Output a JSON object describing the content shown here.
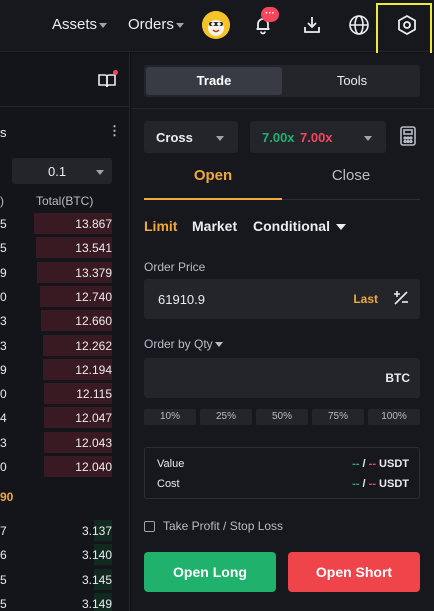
{
  "topbar": {
    "assets_label": "Assets",
    "orders_label": "Orders",
    "notification_badge": "···"
  },
  "orderbook": {
    "title_fragment": "s",
    "depth_value": "0.1",
    "col_left": ")",
    "col_total": "Total(BTC)",
    "asks": [
      {
        "left": "5",
        "total": "13.867",
        "fill": 0.85
      },
      {
        "left": "5",
        "total": "13.541",
        "fill": 0.83
      },
      {
        "left": "9",
        "total": "13.379",
        "fill": 0.82
      },
      {
        "left": "0",
        "total": "12.740",
        "fill": 0.78
      },
      {
        "left": "3",
        "total": "12.660",
        "fill": 0.77
      },
      {
        "left": "3",
        "total": "12.262",
        "fill": 0.75
      },
      {
        "left": "9",
        "total": "12.194",
        "fill": 0.75
      },
      {
        "left": "0",
        "total": "12.115",
        "fill": 0.74
      },
      {
        "left": "4",
        "total": "12.047",
        "fill": 0.74
      },
      {
        "left": "3",
        "total": "12.043",
        "fill": 0.74
      },
      {
        "left": "0",
        "total": "12.040",
        "fill": 0.74
      }
    ],
    "mid_price_fragment": "90",
    "bids": [
      {
        "left": "7",
        "total": "3.137",
        "fill": 0.2
      },
      {
        "left": "6",
        "total": "3.140",
        "fill": 0.2
      },
      {
        "left": "5",
        "total": "3.145",
        "fill": 0.2
      },
      {
        "left": "5",
        "total": "3.149",
        "fill": 0.2
      }
    ],
    "colors": {
      "ask_bar": "#3a1a22",
      "bid_bar": "#12291f"
    }
  },
  "panel": {
    "tabs": {
      "trade": "Trade",
      "tools": "Tools"
    },
    "margin_mode": "Cross",
    "leverage_long": "7.00x",
    "leverage_short": "7.00x",
    "open_tab": "Open",
    "close_tab": "Close",
    "order_types": {
      "limit": "Limit",
      "market": "Market",
      "conditional": "Conditional"
    },
    "order_price_label": "Order Price",
    "order_price_value": "61910.9",
    "last_label": "Last",
    "qty_label": "Order by Qty",
    "qty_unit": "BTC",
    "percentages": [
      "10%",
      "25%",
      "50%",
      "75%",
      "100%"
    ],
    "value_label": "Value",
    "cost_label": "Cost",
    "value_long": "--",
    "value_short": "--",
    "cost_long": "--",
    "cost_short": "--",
    "slash": "/",
    "unit_usdt": "USDT",
    "tpsl_label": "Take Profit / Stop Loss",
    "open_long": "Open Long",
    "open_short": "Open Short"
  },
  "icons": [
    "bell-icon",
    "download-icon",
    "globe-icon",
    "settings-hexagon-icon",
    "book-icon",
    "calculator-icon",
    "plus-minus-icon",
    "chevron-down-icon"
  ]
}
